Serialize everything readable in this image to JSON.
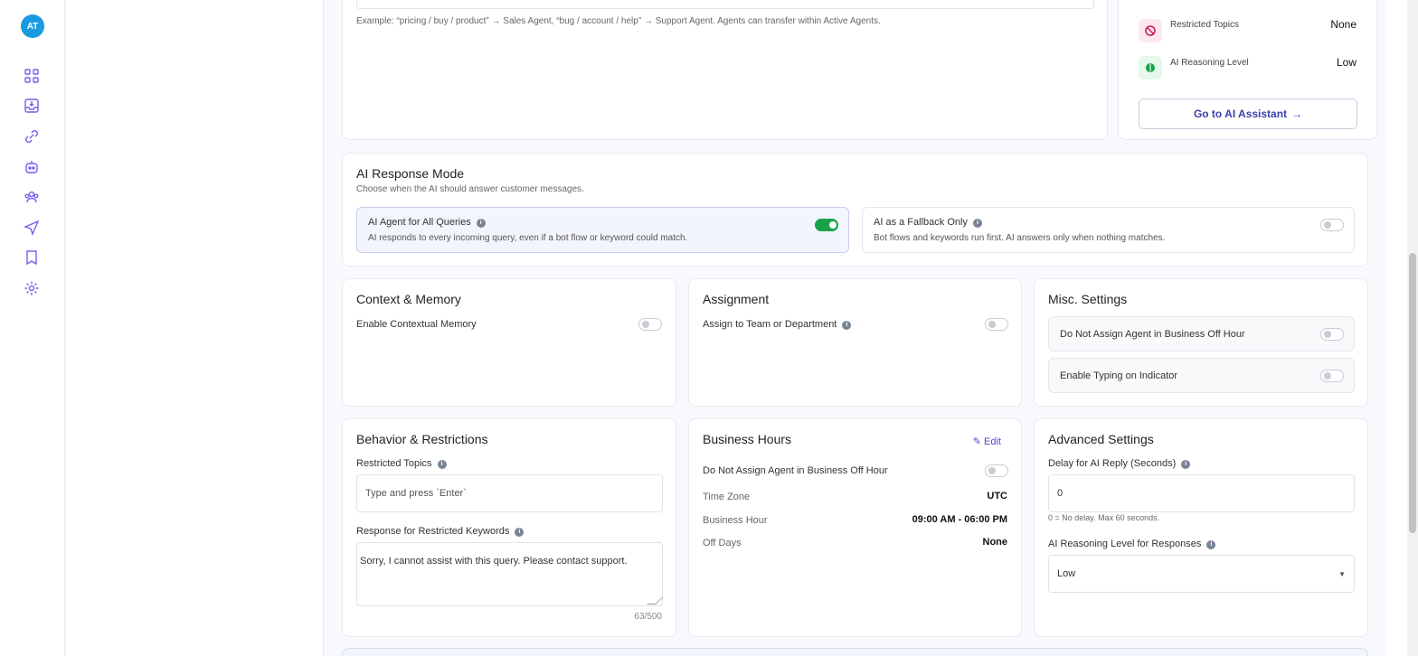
{
  "nav": {
    "avatar_initials": "AT",
    "icons": [
      "dashboard-icon",
      "inbox-icon",
      "integrations-icon",
      "bot-icon",
      "contacts-icon",
      "campaigns-icon",
      "templates-icon",
      "settings-icon"
    ],
    "accent": "#7b5cf0"
  },
  "routing": {
    "example": "Example: “pricing / buy / product” → Sales Agent, “bug / account / help” → Support Agent. Agents can transfer within Active Agents."
  },
  "summary": {
    "restricted_topics_label": "Restricted Topics",
    "restricted_topics_value": "None",
    "reasoning_label": "AI Reasoning Level",
    "reasoning_value": "Low",
    "go_button": "Go to AI Assistant"
  },
  "response_mode": {
    "title": "AI Response Mode",
    "subtitle": "Choose when the AI should answer customer messages.",
    "all_title": "AI Agent for All Queries",
    "all_desc": "AI responds to every incoming query, even if a bot flow or keyword could match.",
    "all_on": true,
    "fallback_title": "AI as a Fallback Only",
    "fallback_desc": "Bot flows and keywords run first. AI answers only when nothing matches.",
    "fallback_on": false
  },
  "context": {
    "title": "Context & Memory",
    "enable_label": "Enable Contextual Memory"
  },
  "assignment": {
    "title": "Assignment",
    "assign_label": "Assign to Team or Department"
  },
  "misc": {
    "title": "Misc. Settings",
    "off_hour_label": "Do Not Assign Agent in Business Off Hour",
    "typing_label": "Enable Typing on Indicator"
  },
  "behavior": {
    "title": "Behavior & Restrictions",
    "restricted_label": "Restricted Topics",
    "restricted_placeholder": "Type and press `Enter`",
    "response_label": "Response for Restricted Keywords",
    "response_value": "Sorry, I cannot assist with this query. Please contact support.",
    "char_count": "63/500"
  },
  "business": {
    "title": "Business Hours",
    "edit": "Edit",
    "off_hour_label": "Do Not Assign Agent in Business Off Hour",
    "timezone_label": "Time Zone",
    "timezone_value": "UTC",
    "hour_label": "Business Hour",
    "hour_value": "09:00 AM - 06:00 PM",
    "offdays_label": "Off Days",
    "offdays_value": "None"
  },
  "advanced": {
    "title": "Advanced Settings",
    "delay_label": "Delay for AI Reply (Seconds)",
    "delay_value": "0",
    "delay_hint": "0 = No delay. Max 60 seconds.",
    "reasoning_label": "AI Reasoning Level for Responses",
    "reasoning_value": "Low"
  }
}
